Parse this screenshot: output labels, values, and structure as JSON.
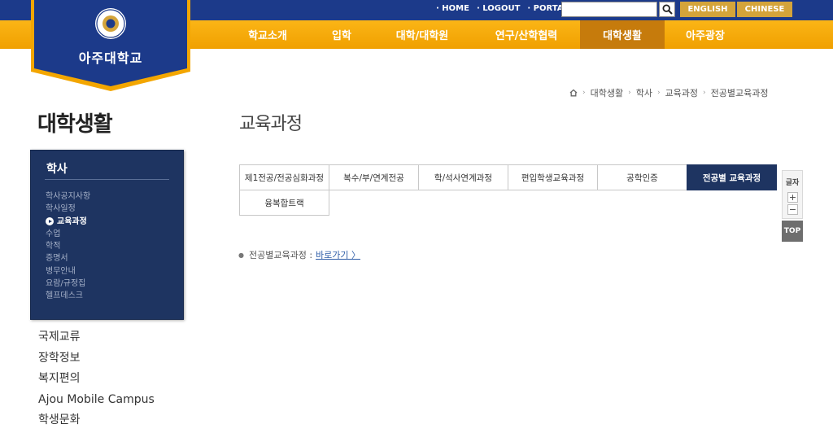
{
  "header": {
    "util_links": [
      "· HOME",
      "· LOGOUT",
      "· PORTAL"
    ],
    "search": {
      "value": "",
      "placeholder": ""
    },
    "lang": {
      "english": "ENGLISH",
      "chinese": "CHINESE"
    },
    "logo": {
      "name": "아주대학교",
      "seal_text": "AJOU UNIVERSITY"
    },
    "nav": [
      {
        "label": "학교소개"
      },
      {
        "label": "입학"
      },
      {
        "label": "대학/대학원"
      },
      {
        "label": "연구/산학협력"
      },
      {
        "label": "대학생활",
        "active": true
      },
      {
        "label": "아주광장"
      }
    ]
  },
  "breadcrumb": [
    "대학생활",
    "학사",
    "교육과정",
    "전공별교육과정"
  ],
  "sidebar": {
    "section_title": "대학생활",
    "box_title": "학사",
    "items": [
      {
        "label": "학사공지사항"
      },
      {
        "label": "학사일정"
      },
      {
        "label": "교육과정",
        "selected": true
      },
      {
        "label": "수업"
      },
      {
        "label": "학적"
      },
      {
        "label": "증명서"
      },
      {
        "label": "병무안내"
      },
      {
        "label": "요람/규정집"
      },
      {
        "label": "헬프데스크"
      }
    ],
    "other_menus": [
      "국제교류",
      "장학정보",
      "복지편의",
      "Ajou Mobile Campus",
      "학생문화"
    ]
  },
  "content": {
    "title": "교육과정",
    "tabs": [
      {
        "label": "제1전공/전공심화과정"
      },
      {
        "label": "복수/부/연계전공"
      },
      {
        "label": "학/석사연계과정"
      },
      {
        "label": "편입학생교육과정"
      },
      {
        "label": "공학인증"
      },
      {
        "label": "전공별 교육과정",
        "active": true
      },
      {
        "label": "융복합트랙"
      }
    ],
    "note_label": "전공별교육과정 :",
    "note_link": "바로가기 〉"
  },
  "side_tools": {
    "font_label": "글자",
    "plus": "+",
    "minus": "−",
    "top": "TOP"
  },
  "colors": {
    "navy": "#1e3461",
    "orange": "#fbb516",
    "top_blue": "#1c3a8a",
    "gold": "#d4a43a"
  }
}
